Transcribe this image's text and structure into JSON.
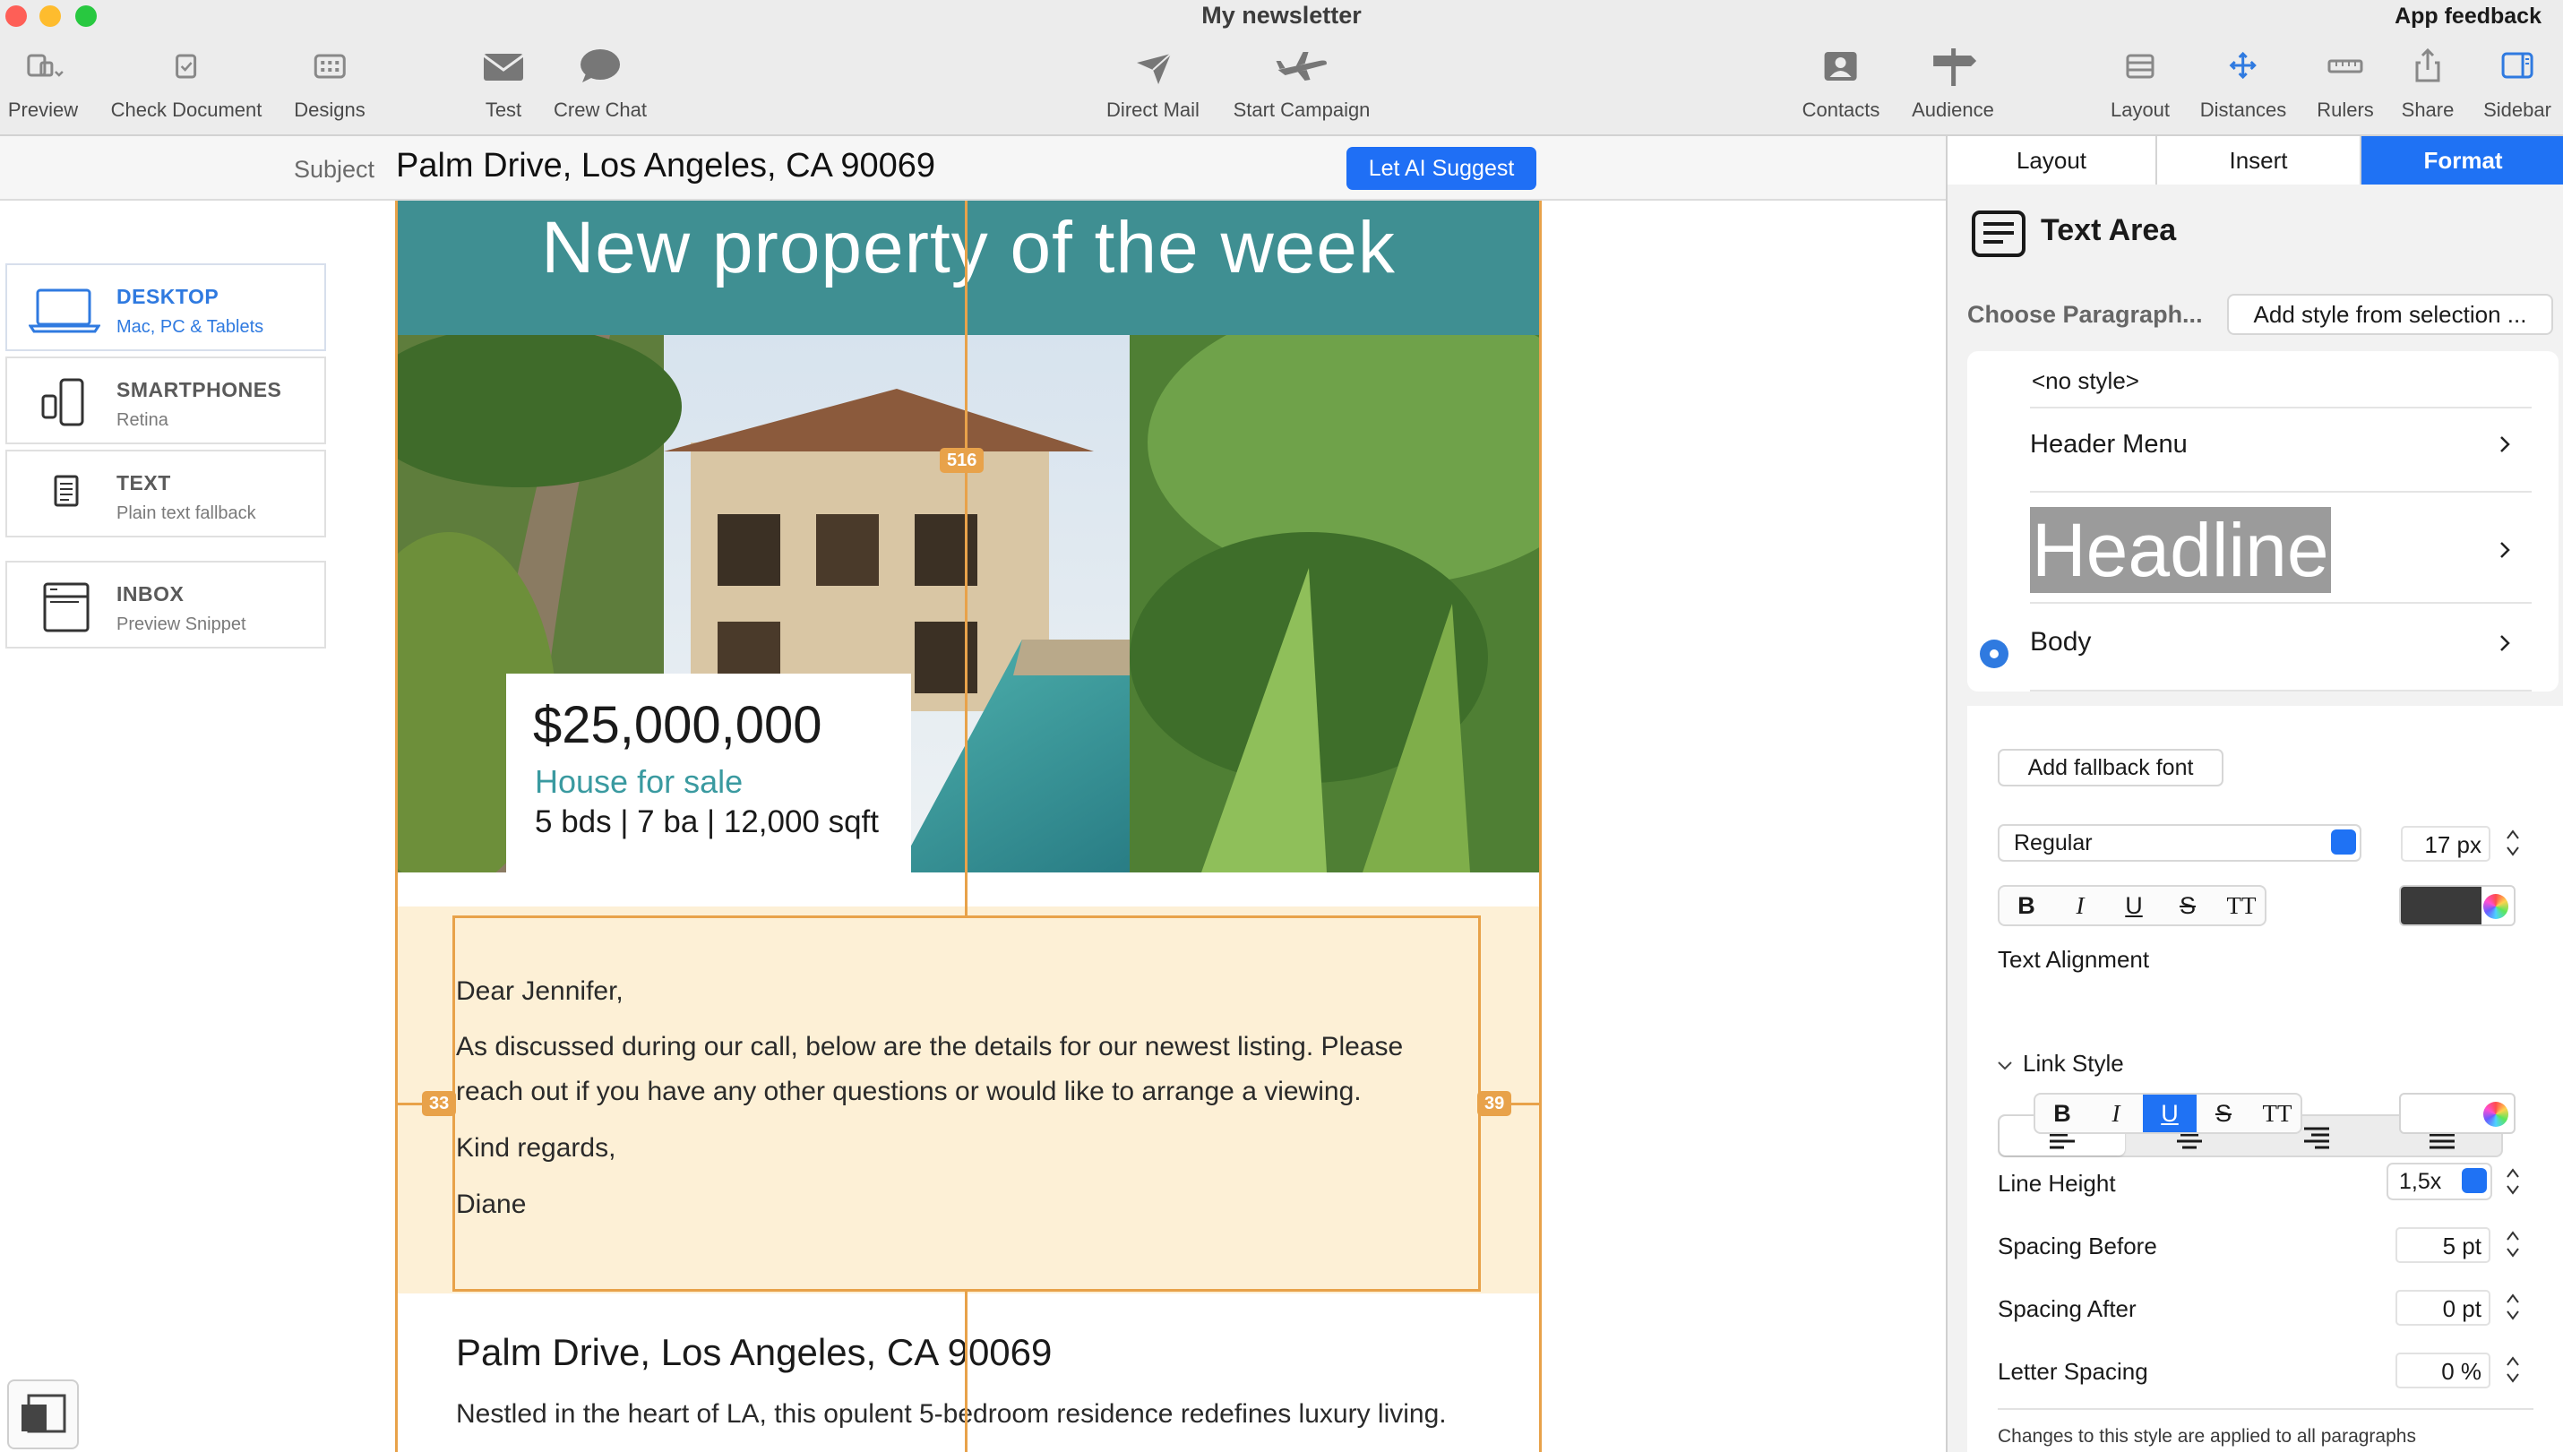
{
  "window": {
    "title": "My newsletter",
    "feedback": "App feedback"
  },
  "toolbar": {
    "preview": "Preview",
    "check_document": "Check Document",
    "designs": "Designs",
    "test": "Test",
    "crew_chat": "Crew Chat",
    "direct_mail": "Direct Mail",
    "start_campaign": "Start Campaign",
    "contacts": "Contacts",
    "audience": "Audience",
    "layout": "Layout",
    "distances": "Distances",
    "rulers": "Rulers",
    "share": "Share",
    "sidebar": "Sidebar"
  },
  "subject": {
    "label": "Subject",
    "value": "Palm Drive, Los Angeles, CA 90069",
    "ai_button": "Let AI Suggest"
  },
  "devices": [
    {
      "name": "DESKTOP",
      "sub": "Mac, PC & Tablets",
      "icon": "laptop-icon",
      "active": true
    },
    {
      "name": "SMARTPHONES",
      "sub": "Retina",
      "icon": "phone-icon",
      "active": false
    },
    {
      "name": "TEXT",
      "sub": "Plain text fallback",
      "icon": "document-icon",
      "active": false
    },
    {
      "name": "INBOX",
      "sub": "Preview Snippet",
      "icon": "inbox-icon",
      "active": false
    }
  ],
  "email": {
    "hero_title": "New property of the week",
    "price": "$25,000,000",
    "type": "House for sale",
    "specs": "5 bds  |  7 ba  |  12,000 sqft",
    "body": {
      "greeting": "Dear Jennifer,",
      "line1": "As discussed during our call, below are the details for our newest listing. Please",
      "line2": "reach out if you have any other questions or would like to arrange a viewing.",
      "closing": "Kind regards,",
      "signature": "Diane"
    },
    "address_title": "Palm Drive, Los Angeles, CA 90069",
    "address_desc": "Nestled in the heart of LA, this opulent 5-bedroom residence redefines luxury living."
  },
  "guides": {
    "width_badge": "516",
    "left_badge": "33",
    "right_badge": "39"
  },
  "sidebar": {
    "tabs": [
      "Layout",
      "Insert",
      "Format"
    ],
    "active_tab": "Format",
    "header": "Text Area",
    "choose_label": "Choose Paragraph...",
    "add_style_button": "Add style from selection ...",
    "styles": {
      "no_style": "<no style>",
      "header_menu": "Header Menu",
      "headline": "Headline",
      "body": "Body"
    },
    "add_fallback": "Add fallback font",
    "font_weight": "Regular",
    "font_size": "17 px",
    "format_buttons": {
      "bold": "B",
      "italic": "I",
      "underline": "U",
      "strike": "S",
      "caps": "TT"
    },
    "text_color": "#3a3a3a",
    "text_alignment_label": "Text Alignment",
    "link_style_label": "Link Style",
    "line_height_label": "Line Height",
    "line_height_value": "1,5x",
    "spacing_before_label": "Spacing Before",
    "spacing_before_value": "5 pt",
    "spacing_after_label": "Spacing After",
    "spacing_after_value": "0 pt",
    "letter_spacing_label": "Letter Spacing",
    "letter_spacing_value": "0 %",
    "footnote": "Changes to this style are applied to all paragraphs"
  },
  "colors": {
    "accent": "#1f72f4",
    "hero_teal": "#3f8f92",
    "guide_orange": "#e8a24a",
    "body_highlight": "#fdf0d6",
    "type_teal": "#3a9aa0"
  }
}
